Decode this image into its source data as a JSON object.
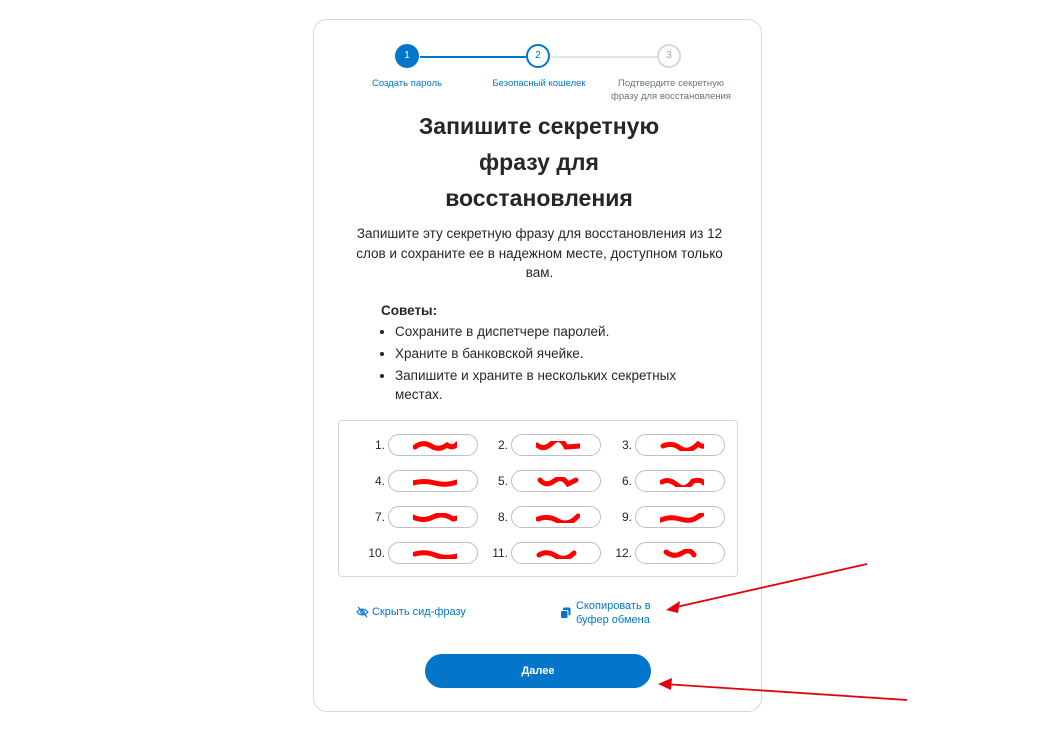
{
  "stepper": {
    "steps": [
      {
        "number": "1",
        "label": "Создать пароль",
        "state": "complete"
      },
      {
        "number": "2",
        "label": "Безопасный кошелек",
        "state": "current"
      },
      {
        "number": "3",
        "label": "Подтвердите секретную фразу для восстановления",
        "state": "upcoming"
      }
    ]
  },
  "title": "Запишите секретную фразу для восстановления",
  "description": "Запишите эту секретную фразу для восстановления из 12 слов и сохраните ее в надежном месте, доступном только вам.",
  "tips": {
    "title": "Советы:",
    "items": [
      "Сохраните в диспетчере паролей.",
      "Храните в банковской ячейке.",
      "Запишите и храните в нескольких секретных местах."
    ]
  },
  "seed_words": [
    "1.",
    "2.",
    "3.",
    "4.",
    "5.",
    "6.",
    "7.",
    "8.",
    "9.",
    "10.",
    "11.",
    "12."
  ],
  "actions": {
    "hide_label": "Скрыть сид-фразу",
    "copy_label": "Скопировать в буфер обмена",
    "next_label": "Далее"
  },
  "colors": {
    "accent": "#0376c9",
    "redaction": "#ff0000",
    "annotation_arrow": "#e3000f"
  },
  "icons": {
    "hide": "eye-slash-icon",
    "copy": "copy-icon"
  }
}
